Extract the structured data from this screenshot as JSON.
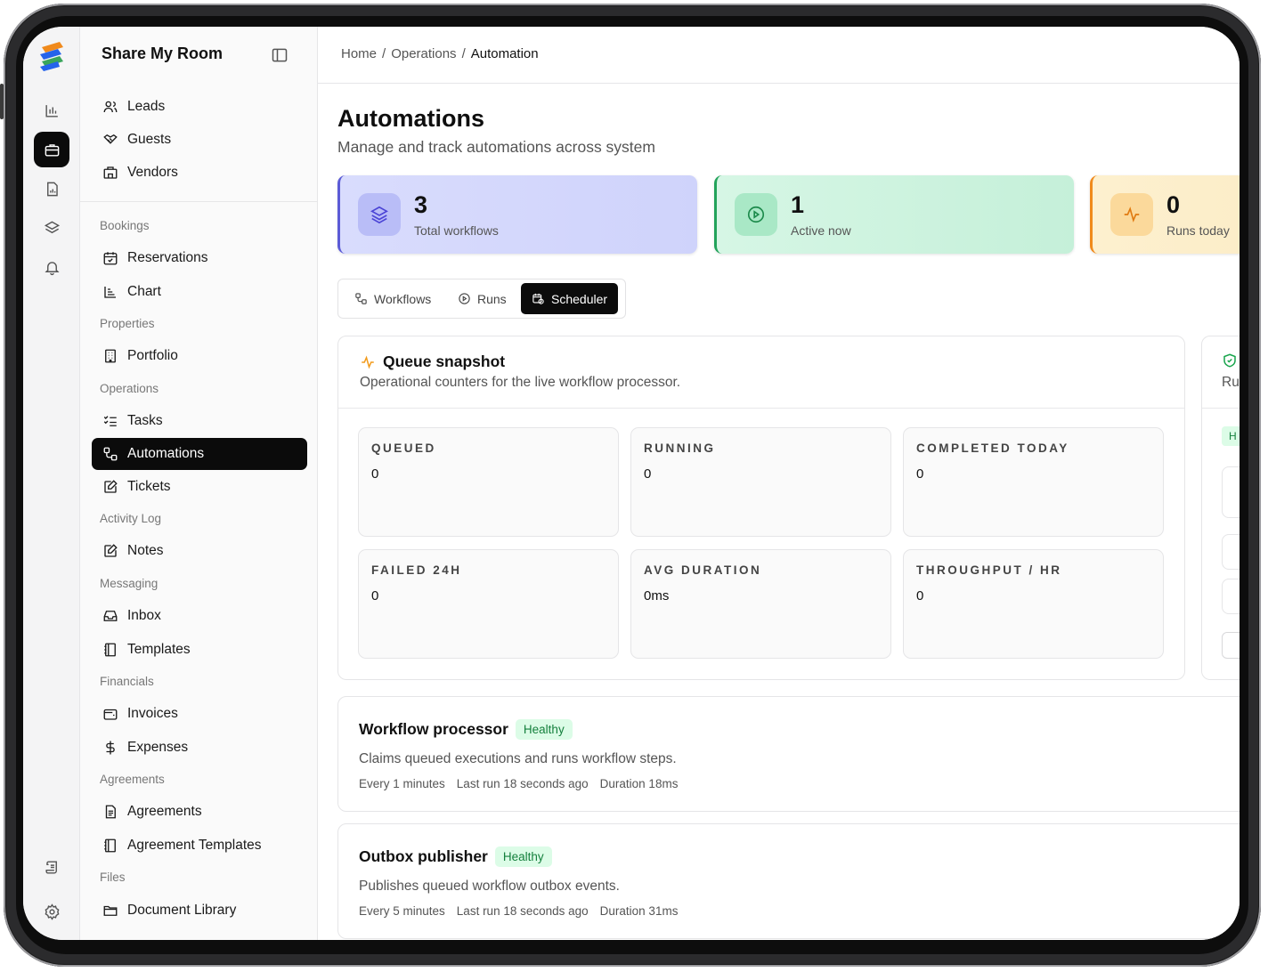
{
  "app": {
    "name": "Share My Room"
  },
  "rail": {
    "items": [
      {
        "icon": "bar-chart-icon",
        "active": false
      },
      {
        "icon": "briefcase-icon",
        "active": true
      },
      {
        "icon": "report-icon",
        "active": false
      },
      {
        "icon": "layers-icon",
        "active": false
      },
      {
        "icon": "bell-icon",
        "active": false
      }
    ],
    "bottom": [
      {
        "icon": "scroll-icon"
      },
      {
        "icon": "settings-icon"
      }
    ]
  },
  "sidebar": {
    "top_items": [
      {
        "label": "Leads",
        "icon": "users-icon"
      },
      {
        "label": "Guests",
        "icon": "handshake-icon"
      },
      {
        "label": "Vendors",
        "icon": "store-icon"
      }
    ],
    "groups": {
      "bookings": "Bookings",
      "properties": "Properties",
      "operations": "Operations",
      "activity_log": "Activity Log",
      "messaging": "Messaging",
      "financials": "Financials",
      "agreements": "Agreements",
      "files": "Files"
    },
    "items": {
      "reservations": "Reservations",
      "chart": "Chart",
      "portfolio": "Portfolio",
      "tasks": "Tasks",
      "automations": "Automations",
      "tickets": "Tickets",
      "notes": "Notes",
      "inbox": "Inbox",
      "templates": "Templates",
      "invoices": "Invoices",
      "expenses": "Expenses",
      "agreements": "Agreements",
      "agreement_templates": "Agreement Templates",
      "document_library": "Document Library"
    },
    "active": "Automations"
  },
  "breadcrumb": {
    "home": "Home",
    "sep": "/",
    "section": "Operations",
    "current": "Automation"
  },
  "page": {
    "title": "Automations",
    "subtitle": "Manage and track automations across system"
  },
  "stats": [
    {
      "value": "3",
      "label": "Total workflows",
      "icon": "layers-icon",
      "accent": "#5b5bd6"
    },
    {
      "value": "1",
      "label": "Active now",
      "icon": "play-circle-icon",
      "accent": "#22a35a"
    },
    {
      "value": "0",
      "label": "Runs today",
      "icon": "activity-icon",
      "accent": "#f08a1c"
    }
  ],
  "tabs": {
    "workflows": "Workflows",
    "runs": "Runs",
    "scheduler": "Scheduler",
    "active": "Scheduler"
  },
  "queue": {
    "title": "Queue snapshot",
    "subtitle": "Operational counters for the live workflow processor.",
    "metrics": [
      {
        "label": "QUEUED",
        "value": "0"
      },
      {
        "label": "RUNNING",
        "value": "0"
      },
      {
        "label": "COMPLETED TODAY",
        "value": "0"
      },
      {
        "label": "FAILED 24H",
        "value": "0"
      },
      {
        "label": "AVG DURATION",
        "value": "0ms"
      },
      {
        "label": "THROUGHPUT / HR",
        "value": "0"
      }
    ]
  },
  "side_panel": {
    "title_fragment": "Ru",
    "badge_fragment": "H"
  },
  "jobs": [
    {
      "name": "Workflow processor",
      "status": "Healthy",
      "description": "Claims queued executions and runs workflow steps.",
      "interval": "Every 1 minutes",
      "last_run": "Last run 18 seconds ago",
      "duration": "Duration 18ms"
    },
    {
      "name": "Outbox publisher",
      "status": "Healthy",
      "description": "Publishes queued workflow outbox events.",
      "interval": "Every 5 minutes",
      "last_run": "Last run 18 seconds ago",
      "duration": "Duration 31ms"
    }
  ],
  "colors": {
    "status_healthy": "#15803d",
    "status_healthy_bg": "#dcfce7",
    "queue_icon": "#f29a1a",
    "active_bg": "#0b0b0b"
  }
}
